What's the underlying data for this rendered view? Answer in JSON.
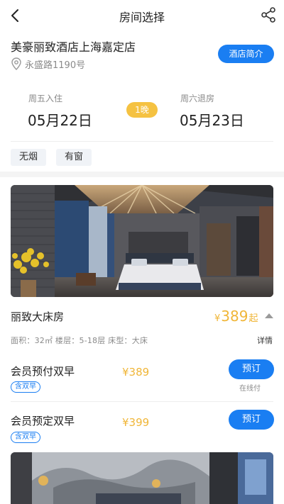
{
  "header": {
    "title": "房间选择"
  },
  "hotel": {
    "name": "美豪丽致酒店上海嘉定店",
    "address": "永盛路1190号",
    "intro_button": "酒店简介"
  },
  "dates": {
    "checkin_label": "周五入住",
    "checkin_date": "05月22日",
    "nights": "1晚",
    "checkout_label": "周六退房",
    "checkout_date": "05月23日"
  },
  "tags": [
    "无烟",
    "有窗"
  ],
  "room": {
    "name": "丽致大床房",
    "currency": "¥",
    "price": "389",
    "price_suffix": "起",
    "info": "面积：32㎡  楼层：5-18层  床型：大床",
    "detail_label": "详情"
  },
  "plans": [
    {
      "name": "会员预付双早",
      "badge": "含双早",
      "price": "¥389",
      "button": "预订",
      "payment_note": "在线付"
    },
    {
      "name": "会员预定双早",
      "badge": "含双早",
      "price": "¥399",
      "button": "预订"
    }
  ],
  "colors": {
    "accent": "#1a7ef2",
    "price": "#f0b638",
    "nights_badge": "#f5c242"
  },
  "icons": {
    "back": "chevron-left-icon",
    "share": "share-icon",
    "location": "location-pin-icon"
  }
}
